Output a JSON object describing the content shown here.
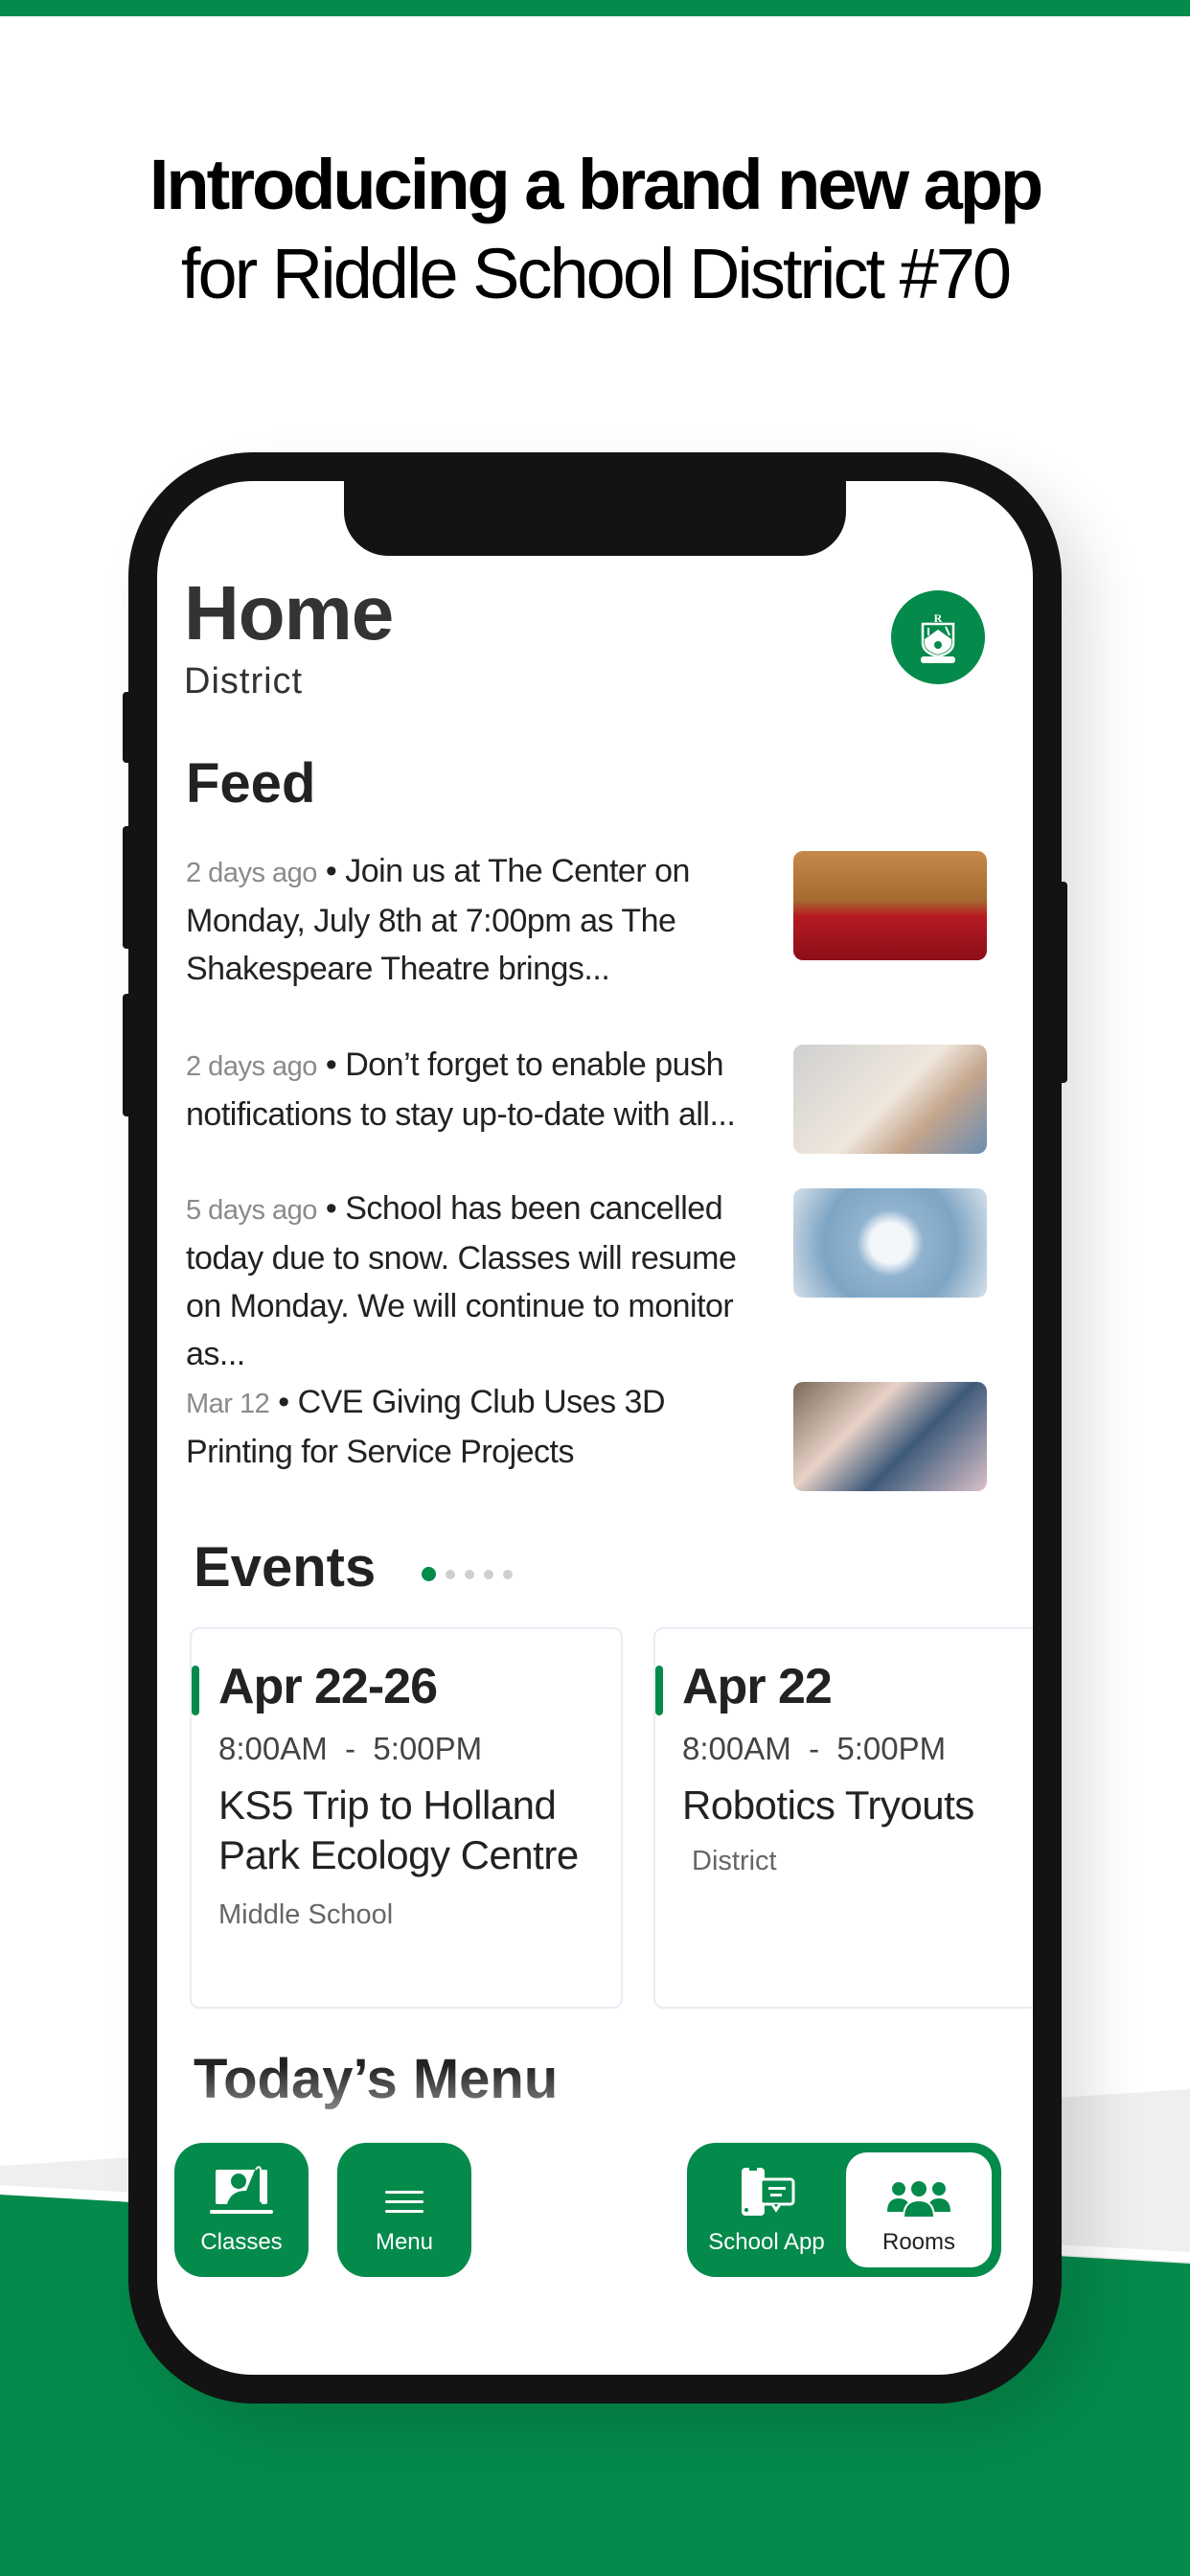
{
  "promo": {
    "headline_line1": "Introducing a brand new app",
    "headline_line2": "for Riddle School District #70"
  },
  "colors": {
    "brand_green": "#048a4b",
    "phone_frame": "#131313",
    "text_dark": "#222222",
    "text_muted": "#8a8a8a"
  },
  "header": {
    "title": "Home",
    "subtitle": "District",
    "logo_icon": "riddle-crest-icon"
  },
  "feed": {
    "heading": "Feed",
    "items": [
      {
        "time": "2 days ago",
        "text": "Join us at The Center on Monday, July 8th at 7:00pm as The Shakespeare Theatre brings...",
        "thumb": "theatre-seats-photo"
      },
      {
        "time": "2 days ago",
        "text": "Don’t forget to enable push notifications to stay up-to-date with all...",
        "thumb": "hands-phone-photo"
      },
      {
        "time": "5 days ago",
        "text": "School has been cancelled today due to snow. Classes will resume on Monday. We will continue to monitor as...",
        "thumb": "mittens-snowflake-photo"
      },
      {
        "time": "Mar 12",
        "text": "CVE Giving Club Uses 3D Printing for Service Projects",
        "thumb": "classroom-kids-photo"
      }
    ]
  },
  "events": {
    "heading": "Events",
    "page_count": 5,
    "active_page": 1,
    "cards": [
      {
        "date": "Apr 22-26",
        "time": "8:00AM  -  5:00PM",
        "title": "KS5 Trip to Holland Park Ecology Centre",
        "location": "Middle School"
      },
      {
        "date": "Apr 22",
        "time": "8:00AM  -  5:00PM",
        "title": "Robotics Tryouts",
        "location": "District"
      }
    ]
  },
  "menu": {
    "heading": "Today’s Menu"
  },
  "bottom_nav": {
    "classes": {
      "label": "Classes",
      "icon": "raised-hand-icon"
    },
    "menu": {
      "label": "Menu",
      "icon": "hamburger-icon"
    },
    "school_app": {
      "label": "School App",
      "icon": "phone-message-icon"
    },
    "rooms": {
      "label": "Rooms",
      "icon": "people-group-icon",
      "selected": true
    }
  }
}
